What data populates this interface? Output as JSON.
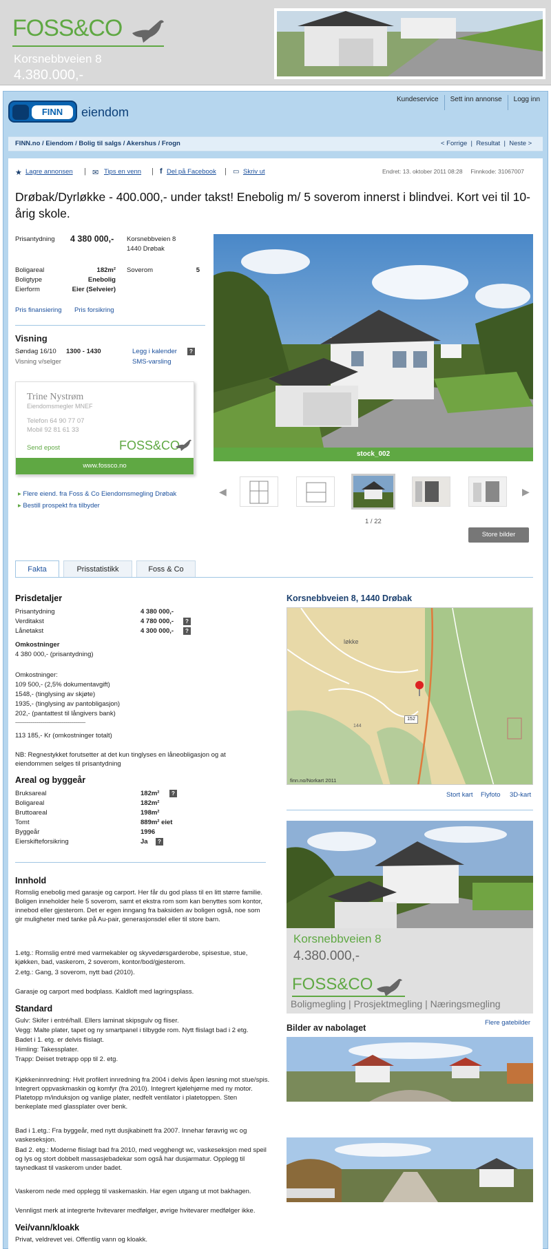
{
  "banner": {
    "brand_left": "FOSS",
    "brand_amp": "&",
    "brand_right": "CO",
    "address": "Korsnebbveien 8",
    "price": "4.380.000,-"
  },
  "header": {
    "finn": "FINN",
    "section": "eiendom",
    "nav": [
      "Kundeservice",
      "Sett inn annonse",
      "Logg inn"
    ]
  },
  "breadcrumb": "FINN.no / Eiendom / Bolig til salgs / Akershus / Frogn",
  "pager": {
    "prev": "< Forrige",
    "result": "Resultat",
    "next": "Neste >"
  },
  "actions": {
    "save": "Lagre annonsen",
    "tip": "Tips en venn",
    "facebook": "Del på Facebook",
    "print": "Skriv ut"
  },
  "meta": {
    "changed": "Endret:  13. oktober 2011 08:28",
    "code": "Finnkode:  31067007"
  },
  "title": "Drøbak/Dyrløkke - 400.000,- under takst! Enebolig m/ 5 soverom innerst i blindvei. Kort vei til 10-årig skole.",
  "facts": {
    "price_label": "Prisantydning",
    "price_value": "4 380 000,-",
    "address1": "Korsnebbveien 8",
    "address2": "1440 Drøbak",
    "boligareal_label": "Boligareal",
    "boligareal_value": "182m²",
    "soverom_label": "Soverom",
    "soverom_value": "5",
    "boligtype_label": "Boligtype",
    "boligtype_value": "Enebolig",
    "eierform_label": "Eierform",
    "eierform_value": "Eier (Selveier)",
    "link_fin": "Pris finansiering",
    "link_ins": "Pris forsikring"
  },
  "visning": {
    "title": "Visning",
    "day": "Søndag 16/10",
    "time": "1300  - 1430",
    "by": "Visning v/selger",
    "cal": "Legg i kalender",
    "sms": "SMS-varsling"
  },
  "agent": {
    "name": "Trine Nystrøm",
    "role": "Eiendomsmegler MNEF",
    "tel": "Telefon  64 90 77 07",
    "mob": "Mobil  92 81 61 33",
    "mail": "Send epost",
    "web": "www.fossco.no"
  },
  "links": {
    "more": "Flere eiend. fra Foss & Co Eiendomsmegling Drøbak",
    "prospekt": "Bestill prospekt fra tilbyder"
  },
  "photo": {
    "caption": "stock_002",
    "counter": "1 / 22",
    "big": "Store bilder"
  },
  "tabs": [
    "Fakta",
    "Prisstatistikk",
    "Foss & Co"
  ],
  "prisdetaljer": {
    "title": "Prisdetaljer",
    "rows": [
      [
        "Prisantydning",
        "4 380 000,-"
      ],
      [
        "Verditakst",
        "4 780 000,-"
      ],
      [
        "Lånetakst",
        "4 300 000,-"
      ]
    ],
    "omk_title": "Omkostninger",
    "omk_base": "4 380 000,- (prisantydning)",
    "omk_lines": [
      "Omkostninger:",
      "109 500,- (2,5% dokumentavgift)",
      "1548,- (tinglysing av skjøte)",
      "1935,- (tinglysing av pantobligasjon)",
      "202,- (pantattest til långivers bank)",
      "--------------------------------------------------------------------",
      "113 185,- Kr (omkostninger totalt)"
    ],
    "nb": "NB: Regnestykket forutsetter at det kun tinglyses en låneobligasjon og at eiendommen selges til prisantydning"
  },
  "areal": {
    "title": "Areal og byggeår",
    "rows": [
      [
        "Bruksareal",
        "182m²"
      ],
      [
        "Boligareal",
        "182m²"
      ],
      [
        "Bruttoareal",
        "198m²"
      ],
      [
        "Tomt",
        "889m² eiet"
      ],
      [
        "Byggeår",
        "1996"
      ],
      [
        "Eierskifteforsikring",
        "Ja"
      ]
    ]
  },
  "innhold": {
    "title": "Innhold",
    "p1": "Romslig enebolig med garasje og carport. Her får du god plass til en litt større familie. Boligen inneholder hele 5 soverom, samt et ekstra rom som kan benyttes som kontor, innebod eller gjesterom. Det er egen inngang fra baksiden av boligen også, noe som gir muligheter med tanke på Au-pair, generasjonsdel eller til store barn.",
    "p2": "1.etg.: Romslig entré med varmekabler og skyvedørsgarderobe, spisestue, stue, kjøkken, bad, vaskerom, 2 soverom, kontor/bod/gjesterom.",
    "p3": "2.etg.: Gang, 3 soverom, nytt bad (2010).",
    "p4": "Garasje og carport med bodplass. Kaldloft med lagringsplass."
  },
  "standard": {
    "title": "Standard",
    "lines": [
      "Gulv: Skifer i entré/hall. Ellers laminat skipsgulv og fliser.",
      "Vegg: Malte plater, tapet og ny smartpanel i tilbygde rom. Nytt flislagt bad i 2 etg.",
      "Badet i 1. etg. er delvis flislagt.",
      "Himling: Takessplater.",
      "Trapp: Deiset tretrapp opp til 2. etg."
    ],
    "k": "Kjøkkeninnredning: Hvit profilert innredning fra 2004 i delvis åpen løsning mot stue/spis. Integrert oppvaskmaskin og komfyr (fra 2010). Integrert kjølehjørne med ny motor. Platetopp m/induksjon og vanlige plater, nedfelt ventilator i platetoppen. Sten benkeplate med glassplater over benk.",
    "b1": "Bad i 1.etg.: Fra byggeår, med nytt dusjkabinett fra 2007. Innehar føravrig wc og vaskeseksjon.",
    "b2": "Bad 2. etg.: Moderne flislagt bad fra 2010, med vegghengt wc, vaskeseksjon med speil og lys og stort dobbelt massasjebadekar som også har dusjarmatur. Opplegg til taynedkast til vaskerom under badet.",
    "v": "Vaskerom nede med opplegg til vaskemaskin. Har egen utgang ut mot bakhagen.",
    "h": "Vennligst merk at integrerte hvitevarer medfølger, øvrige hvitevarer medfølger ikke."
  },
  "vei": {
    "title": "Vei/vann/kloakk",
    "text": "Privat, veldrevet vei. Offentlig vann og kloakk."
  },
  "map": {
    "title": "Korsnebbveien 8, 1440 Drøbak",
    "place": "løkke",
    "road": "152",
    "num": "144",
    "credit": "finn.no/Norkart 2011",
    "links": [
      "Stort kart",
      "Flyfoto",
      "3D-kart"
    ]
  },
  "ad": {
    "address": "Korsnebbveien 8",
    "price": "4.380.000,-",
    "tagline": "Boligmegling | Prosjektmegling | Næringsmegling"
  },
  "nabolag": {
    "title": "Bilder av nabolaget",
    "more": "Flere gatebilder"
  }
}
